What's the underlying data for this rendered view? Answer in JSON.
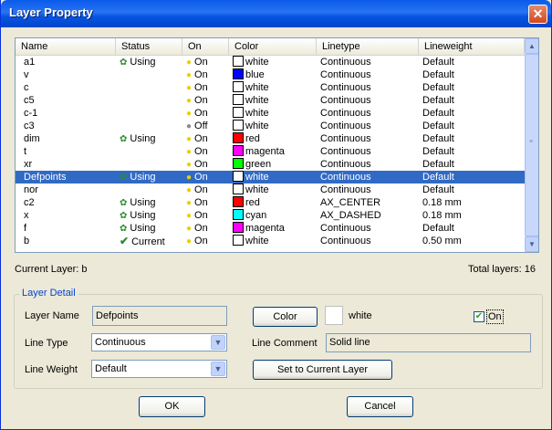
{
  "window": {
    "title": "Layer Property",
    "close_glyph": "✕"
  },
  "columns": [
    "Name",
    "Status",
    "On",
    "Color",
    "Linetype",
    "Lineweight"
  ],
  "rows": [
    {
      "name": "a1",
      "status": "Using",
      "status_icon": "gear",
      "on": "On",
      "color_name": "white",
      "color_hex": "#FFFFFF",
      "linetype": "Continuous",
      "lineweight": "Default",
      "selected": false
    },
    {
      "name": "v",
      "status": "",
      "status_icon": "",
      "on": "On",
      "color_name": "blue",
      "color_hex": "#0000FF",
      "linetype": "Continuous",
      "lineweight": "Default",
      "selected": false
    },
    {
      "name": "c",
      "status": "",
      "status_icon": "",
      "on": "On",
      "color_name": "white",
      "color_hex": "#FFFFFF",
      "linetype": "Continuous",
      "lineweight": "Default",
      "selected": false
    },
    {
      "name": "c5",
      "status": "",
      "status_icon": "",
      "on": "On",
      "color_name": "white",
      "color_hex": "#FFFFFF",
      "linetype": "Continuous",
      "lineweight": "Default",
      "selected": false
    },
    {
      "name": "c-1",
      "status": "",
      "status_icon": "",
      "on": "On",
      "color_name": "white",
      "color_hex": "#FFFFFF",
      "linetype": "Continuous",
      "lineweight": "Default",
      "selected": false
    },
    {
      "name": "c3",
      "status": "",
      "status_icon": "",
      "on": "Off",
      "color_name": "white",
      "color_hex": "#FFFFFF",
      "linetype": "Continuous",
      "lineweight": "Default",
      "selected": false
    },
    {
      "name": "dim",
      "status": "Using",
      "status_icon": "gear",
      "on": "On",
      "color_name": "red",
      "color_hex": "#FF0000",
      "linetype": "Continuous",
      "lineweight": "Default",
      "selected": false
    },
    {
      "name": "t",
      "status": "",
      "status_icon": "",
      "on": "On",
      "color_name": "magenta",
      "color_hex": "#FF00FF",
      "linetype": "Continuous",
      "lineweight": "Default",
      "selected": false
    },
    {
      "name": "xr",
      "status": "",
      "status_icon": "",
      "on": "On",
      "color_name": "green",
      "color_hex": "#00FF00",
      "linetype": "Continuous",
      "lineweight": "Default",
      "selected": false
    },
    {
      "name": "Defpoints",
      "status": "Using",
      "status_icon": "gear",
      "on": "On",
      "color_name": "white",
      "color_hex": "#FFFFFF",
      "linetype": "Continuous",
      "lineweight": "Default",
      "selected": true
    },
    {
      "name": "nor",
      "status": "",
      "status_icon": "",
      "on": "On",
      "color_name": "white",
      "color_hex": "#FFFFFF",
      "linetype": "Continuous",
      "lineweight": "Default",
      "selected": false
    },
    {
      "name": "c2",
      "status": "Using",
      "status_icon": "gear",
      "on": "On",
      "color_name": "red",
      "color_hex": "#FF0000",
      "linetype": "AX_CENTER",
      "lineweight": "0.18 mm",
      "selected": false
    },
    {
      "name": "x",
      "status": "Using",
      "status_icon": "gear",
      "on": "On",
      "color_name": "cyan",
      "color_hex": "#00FFFF",
      "linetype": "AX_DASHED",
      "lineweight": "0.18 mm",
      "selected": false
    },
    {
      "name": "f",
      "status": "Using",
      "status_icon": "gear",
      "on": "On",
      "color_name": "magenta",
      "color_hex": "#FF00FF",
      "linetype": "Continuous",
      "lineweight": "Default",
      "selected": false
    },
    {
      "name": "b",
      "status": "Current",
      "status_icon": "check",
      "on": "On",
      "color_name": "white",
      "color_hex": "#FFFFFF",
      "linetype": "Continuous",
      "lineweight": "0.50 mm",
      "selected": false
    }
  ],
  "summary": {
    "current_layer": "Current Layer: b",
    "total_layers": "Total layers: 16"
  },
  "detail": {
    "group_title": "Layer Detail",
    "layer_name_label": "Layer Name",
    "layer_name_value": "Defpoints",
    "line_type_label": "Line Type",
    "line_type_value": "Continuous",
    "line_weight_label": "Line Weight",
    "line_weight_value": "Default",
    "color_button": "Color",
    "color_value": "white",
    "on_label": "On",
    "on_checked": true,
    "line_comment_label": "Line Comment",
    "line_comment_value": "Solid line",
    "set_current_button": "Set to Current Layer"
  },
  "footer": {
    "ok": "OK",
    "cancel": "Cancel"
  }
}
